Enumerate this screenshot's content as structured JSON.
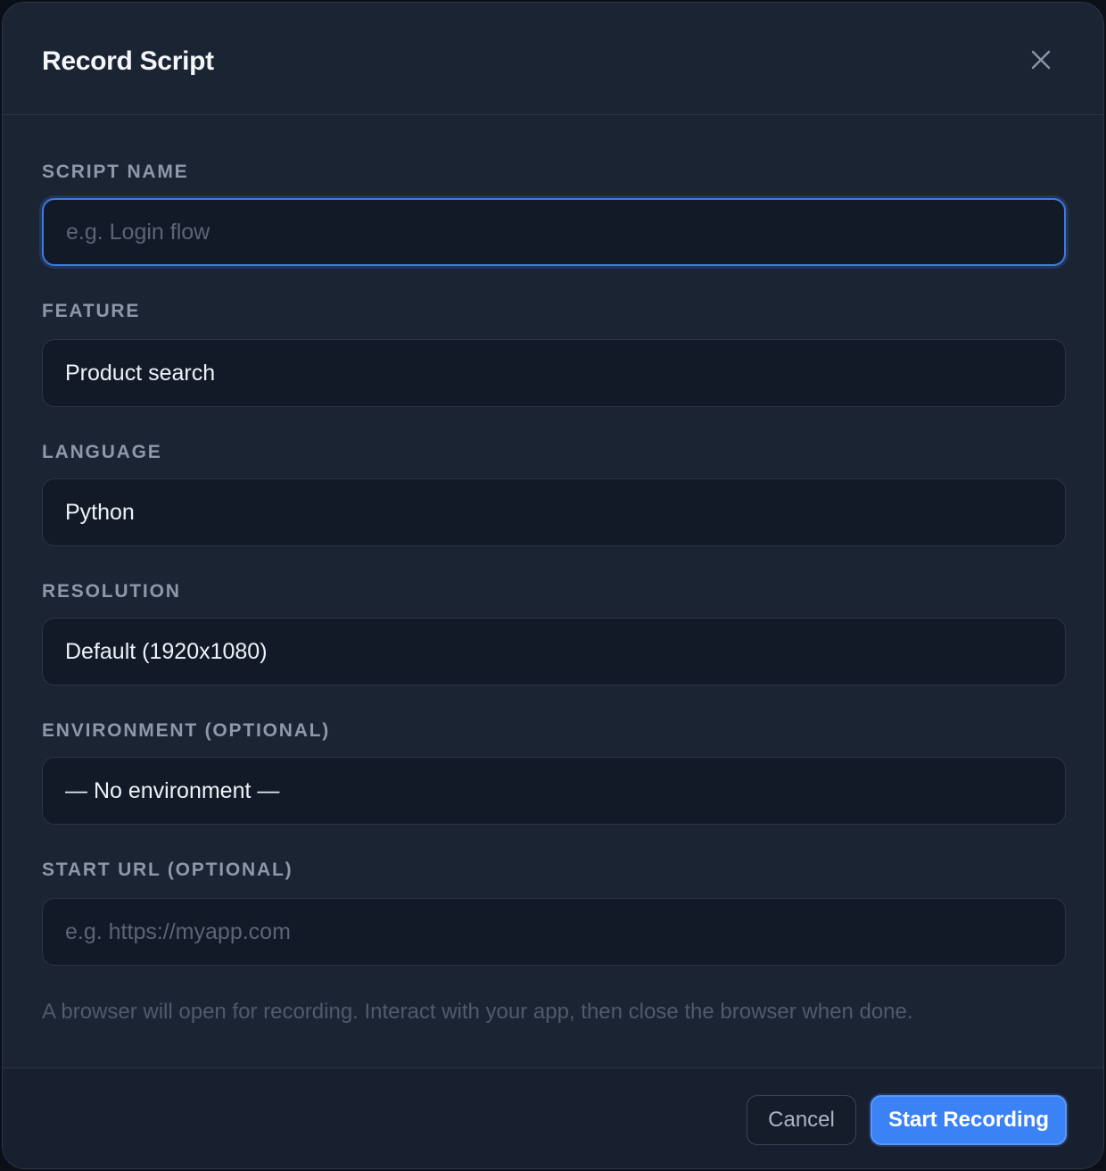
{
  "dialog": {
    "title": "Record Script"
  },
  "fields": {
    "script_name": {
      "label": "SCRIPT NAME",
      "value": "",
      "placeholder": "e.g. Login flow"
    },
    "feature": {
      "label": "FEATURE",
      "value": "Product search"
    },
    "language": {
      "label": "LANGUAGE",
      "value": "Python"
    },
    "resolution": {
      "label": "RESOLUTION",
      "value": "Default (1920x1080)"
    },
    "environment": {
      "label": "ENVIRONMENT (OPTIONAL)",
      "value": "— No environment —"
    },
    "start_url": {
      "label": "START URL (OPTIONAL)",
      "value": "",
      "placeholder": "e.g. https://myapp.com"
    }
  },
  "hint": "A browser will open for recording. Interact with your app, then close the browser when done.",
  "footer": {
    "cancel_label": "Cancel",
    "start_label": "Start Recording"
  },
  "icons": {
    "close": "close-icon"
  },
  "colors": {
    "accent": "#3b82f6",
    "background": "#1b2433",
    "field": "#131a27"
  }
}
